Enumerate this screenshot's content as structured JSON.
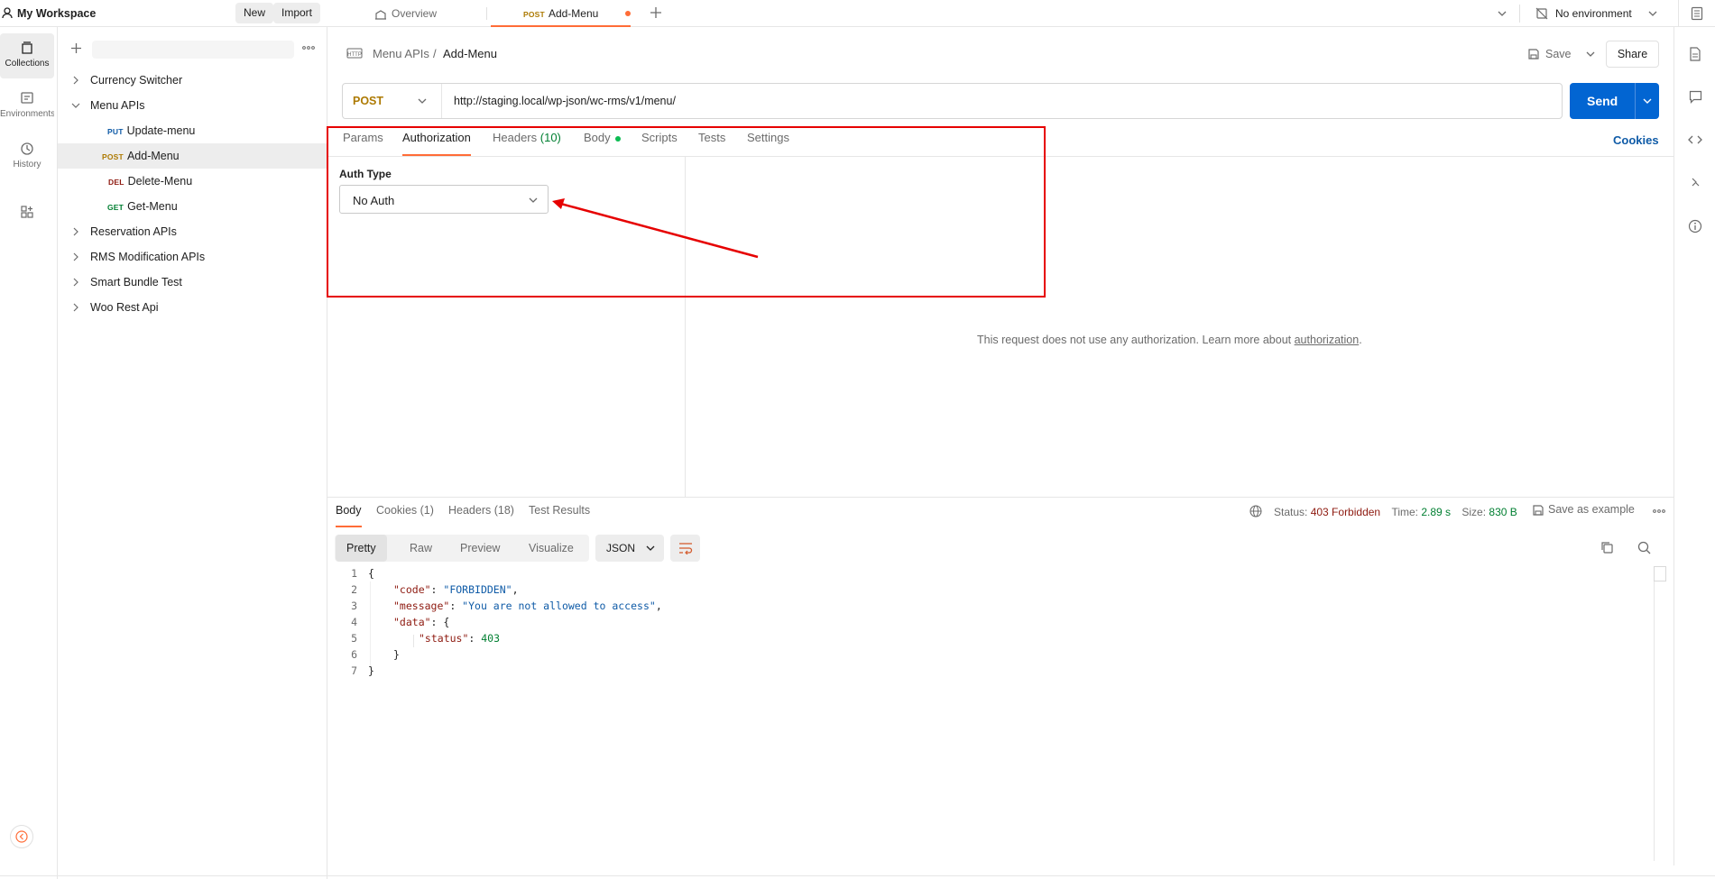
{
  "workspace": {
    "name": "My Workspace",
    "new_label": "New",
    "import_label": "Import"
  },
  "tabs": [
    {
      "label": "Overview"
    },
    {
      "method": "POST",
      "label": "Add-Menu"
    }
  ],
  "environment": {
    "label": "No environment"
  },
  "rail": [
    {
      "label": "Collections"
    },
    {
      "label": "Environments"
    },
    {
      "label": "History"
    }
  ],
  "tree": [
    {
      "label": "Currency Switcher"
    },
    {
      "label": "Menu APIs"
    },
    {
      "method": "PUT",
      "label": "Update-menu"
    },
    {
      "method": "POST",
      "label": "Add-Menu"
    },
    {
      "method": "DEL",
      "label": "Delete-Menu"
    },
    {
      "method": "GET",
      "label": "Get-Menu"
    },
    {
      "label": "Reservation APIs"
    },
    {
      "label": "RMS Modification APIs"
    },
    {
      "label": "Smart Bundle Test"
    },
    {
      "label": "Woo Rest Api"
    }
  ],
  "breadcrumb": {
    "collection": "Menu APIs",
    "separator": "/",
    "request": "Add-Menu"
  },
  "actions": {
    "save": "Save",
    "share": "Share"
  },
  "request": {
    "method": "POST",
    "url": "http://staging.local/wp-json/wc-rms/v1/menu/",
    "send": "Send"
  },
  "req_tabs": [
    {
      "label": "Params"
    },
    {
      "label": "Authorization"
    },
    {
      "label": "Headers",
      "count": "(10)"
    },
    {
      "label": "Body"
    },
    {
      "label": "Scripts"
    },
    {
      "label": "Tests"
    },
    {
      "label": "Settings"
    }
  ],
  "cookies_link": "Cookies",
  "auth": {
    "type_label": "Auth Type",
    "selected": "No Auth",
    "note_prefix": "This request does not use any authorization. Learn more about ",
    "note_link": "authorization",
    "note_suffix": "."
  },
  "resp_tabs": [
    {
      "label": "Body"
    },
    {
      "label": "Cookies (1)"
    },
    {
      "label": "Headers (18)"
    },
    {
      "label": "Test Results"
    }
  ],
  "resp_meta": {
    "status_label": "Status:",
    "status_value": "403 Forbidden",
    "time_label": "Time:",
    "time_value": "2.89 s",
    "size_label": "Size:",
    "size_value": "830 B",
    "save_example": "Save as example"
  },
  "view_modes": [
    "Pretty",
    "Raw",
    "Preview",
    "Visualize"
  ],
  "format": "JSON",
  "code": [
    {
      "n": "1",
      "t": "{"
    },
    {
      "n": "2",
      "key": "\"code\"",
      "val": "\"FORBIDDEN\"",
      "end": ","
    },
    {
      "n": "3",
      "key": "\"message\"",
      "val": "\"You are not allowed to access\"",
      "end": ","
    },
    {
      "n": "4",
      "key": "\"data\"",
      "val": "{",
      "end": ""
    },
    {
      "n": "5",
      "key": "\"status\"",
      "num": "403"
    },
    {
      "n": "6",
      "t": "}"
    },
    {
      "n": "7",
      "t": "}"
    }
  ],
  "colors": {
    "accent": "#ff6c37",
    "send": "#0265d2",
    "annotation": "#e60000"
  }
}
